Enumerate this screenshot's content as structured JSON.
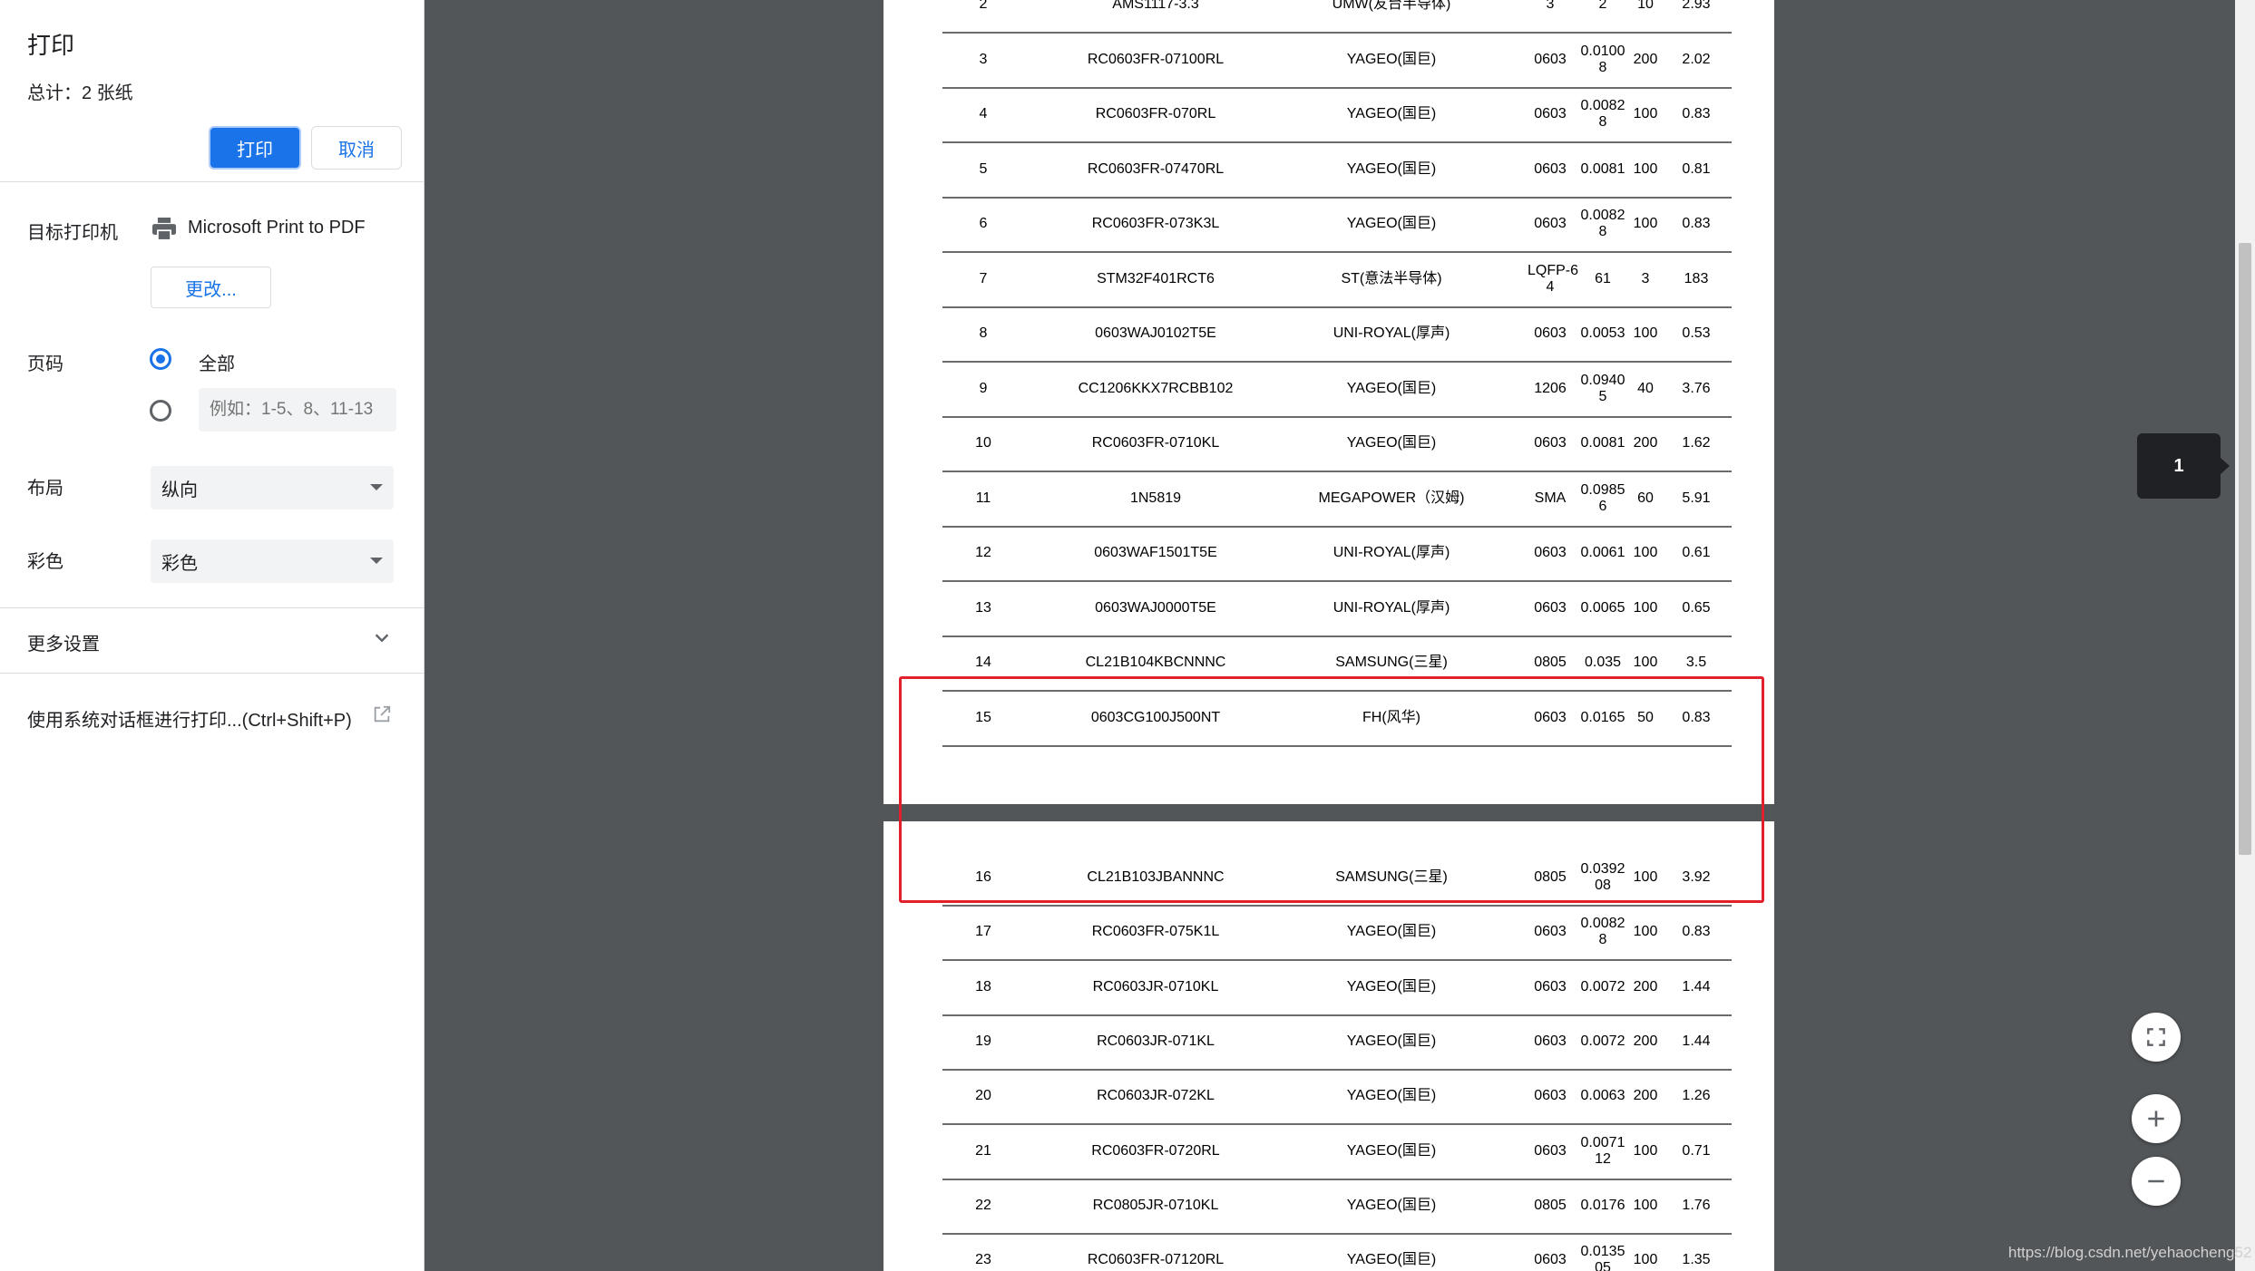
{
  "panel": {
    "title": "打印",
    "total": "总计：2 张纸",
    "print_label": "打印",
    "cancel_label": "取消",
    "destination_label": "目标打印机",
    "printer_name": "Microsoft Print to PDF",
    "change_label": "更改...",
    "pages_label": "页码",
    "pages_all": "全部",
    "pages_placeholder": "例如：1-5、8、11-13",
    "layout_label": "布局",
    "layout_value": "纵向",
    "color_label": "彩色",
    "color_value": "彩色",
    "more_settings": "更多设置",
    "system_dialog": "使用系统对话框进行打印...(Ctrl+Shift+P)"
  },
  "preview": {
    "page_number": "1",
    "watermark": "https://blog.csdn.net/yehaocheng52"
  },
  "table": {
    "page1": [
      {
        "no": "2",
        "part": "AMS1117-3.3",
        "maker": "UMW(友台半导体)",
        "pkg": "3",
        "price": "2",
        "qty": "10",
        "total": "2.93"
      },
      {
        "no": "3",
        "part": "RC0603FR-07100RL",
        "maker": "YAGEO(国巨)",
        "pkg": "0603",
        "price": "0.0100\n8",
        "qty": "200",
        "total": "2.02"
      },
      {
        "no": "4",
        "part": "RC0603FR-070RL",
        "maker": "YAGEO(国巨)",
        "pkg": "0603",
        "price": "0.0082\n8",
        "qty": "100",
        "total": "0.83"
      },
      {
        "no": "5",
        "part": "RC0603FR-07470RL",
        "maker": "YAGEO(国巨)",
        "pkg": "0603",
        "price": "0.0081",
        "qty": "100",
        "total": "0.81"
      },
      {
        "no": "6",
        "part": "RC0603FR-073K3L",
        "maker": "YAGEO(国巨)",
        "pkg": "0603",
        "price": "0.0082\n8",
        "qty": "100",
        "total": "0.83"
      },
      {
        "no": "7",
        "part": "STM32F401RCT6",
        "maker": "ST(意法半导体)",
        "pkg": "LQFP-6\n4",
        "price": "61",
        "qty": "3",
        "total": "183"
      },
      {
        "no": "8",
        "part": "0603WAJ0102T5E",
        "maker": "UNI-ROYAL(厚声)",
        "pkg": "0603",
        "price": "0.0053",
        "qty": "100",
        "total": "0.53"
      },
      {
        "no": "9",
        "part": "CC1206KKX7RCBB102",
        "maker": "YAGEO(国巨)",
        "pkg": "1206",
        "price": "0.0940\n5",
        "qty": "40",
        "total": "3.76"
      },
      {
        "no": "10",
        "part": "RC0603FR-0710KL",
        "maker": "YAGEO(国巨)",
        "pkg": "0603",
        "price": "0.0081",
        "qty": "200",
        "total": "1.62"
      },
      {
        "no": "11",
        "part": "1N5819",
        "maker": "MEGAPOWER（汉姆)",
        "pkg": "SMA",
        "price": "0.0985\n6",
        "qty": "60",
        "total": "5.91"
      },
      {
        "no": "12",
        "part": "0603WAF1501T5E",
        "maker": "UNI-ROYAL(厚声)",
        "pkg": "0603",
        "price": "0.0061",
        "qty": "100",
        "total": "0.61"
      },
      {
        "no": "13",
        "part": "0603WAJ0000T5E",
        "maker": "UNI-ROYAL(厚声)",
        "pkg": "0603",
        "price": "0.0065",
        "qty": "100",
        "total": "0.65"
      },
      {
        "no": "14",
        "part": "CL21B104KBCNNNC",
        "maker": "SAMSUNG(三星)",
        "pkg": "0805",
        "price": "0.035",
        "qty": "100",
        "total": "3.5"
      },
      {
        "no": "15",
        "part": "0603CG100J500NT",
        "maker": "FH(风华)",
        "pkg": "0603",
        "price": "0.0165",
        "qty": "50",
        "total": "0.83"
      }
    ],
    "page2": [
      {
        "no": "16",
        "part": "CL21B103JBANNNC",
        "maker": "SAMSUNG(三星)",
        "pkg": "0805",
        "price": "0.0392\n08",
        "qty": "100",
        "total": "3.92"
      },
      {
        "no": "17",
        "part": "RC0603FR-075K1L",
        "maker": "YAGEO(国巨)",
        "pkg": "0603",
        "price": "0.0082\n8",
        "qty": "100",
        "total": "0.83"
      },
      {
        "no": "18",
        "part": "RC0603JR-0710KL",
        "maker": "YAGEO(国巨)",
        "pkg": "0603",
        "price": "0.0072",
        "qty": "200",
        "total": "1.44"
      },
      {
        "no": "19",
        "part": "RC0603JR-071KL",
        "maker": "YAGEO(国巨)",
        "pkg": "0603",
        "price": "0.0072",
        "qty": "200",
        "total": "1.44"
      },
      {
        "no": "20",
        "part": "RC0603JR-072KL",
        "maker": "YAGEO(国巨)",
        "pkg": "0603",
        "price": "0.0063",
        "qty": "200",
        "total": "1.26"
      },
      {
        "no": "21",
        "part": "RC0603FR-0720RL",
        "maker": "YAGEO(国巨)",
        "pkg": "0603",
        "price": "0.0071\n12",
        "qty": "100",
        "total": "0.71"
      },
      {
        "no": "22",
        "part": "RC0805JR-0710KL",
        "maker": "YAGEO(国巨)",
        "pkg": "0805",
        "price": "0.0176",
        "qty": "100",
        "total": "1.76"
      },
      {
        "no": "23",
        "part": "RC0603FR-07120RL",
        "maker": "YAGEO(国巨)",
        "pkg": "0603",
        "price": "0.0135\n05",
        "qty": "100",
        "total": "1.35"
      }
    ]
  },
  "icons": {
    "printer": "printer-icon",
    "more": "chevron-down-icon",
    "external": "open-in-new-icon",
    "fit": "fit-to-page-icon",
    "zoom_in": "zoom-in-icon",
    "zoom_out": "zoom-out-icon"
  },
  "colors": {
    "accent": "#1a73e8",
    "highlight": "#e0202a"
  }
}
